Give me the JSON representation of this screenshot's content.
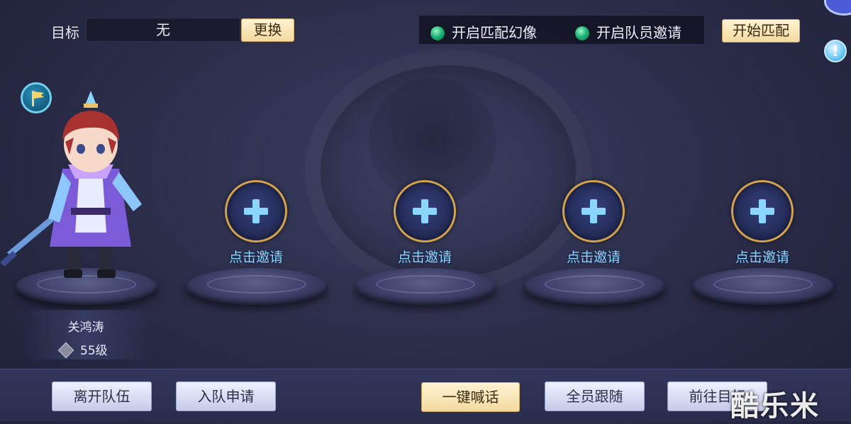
{
  "top_bar": {
    "target_label": "目标",
    "target_value": "无",
    "change_button": "更换",
    "option_match_phantom": "开启匹配幻像",
    "option_member_invite": "开启队员邀请",
    "start_match_button": "开始匹配",
    "info_symbol": "!"
  },
  "player": {
    "name": "关鸿涛",
    "level": "55级"
  },
  "invite_slots": [
    {
      "label": "点击邀请"
    },
    {
      "label": "点击邀请"
    },
    {
      "label": "点击邀请"
    },
    {
      "label": "点击邀请"
    }
  ],
  "bottom_bar": {
    "leave_team": "离开队伍",
    "join_request": "入队申请",
    "one_key_shout": "一键喊话",
    "all_follow": "全员跟随",
    "go_to_target": "前往目标"
  },
  "watermark": "酷乐米",
  "icons": {
    "flag": "team-flag-icon",
    "info": "info-icon",
    "plus": "plus-icon",
    "level": "level-badge-icon",
    "toggle": "green-toggle-icon"
  },
  "colors": {
    "background": "#2a2c48",
    "gold_button": "#f4d9a0",
    "invite_ring": "#d2a24f",
    "invite_text": "#8ad6ff",
    "toggle_on": "#1fb678"
  }
}
